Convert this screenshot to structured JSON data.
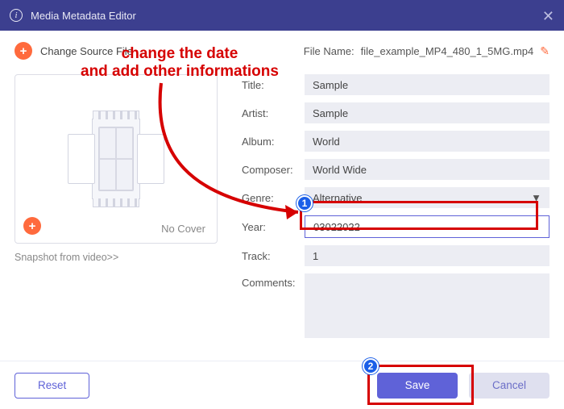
{
  "titlebar": {
    "title": "Media Metadata Editor"
  },
  "toprow": {
    "change_label": "Change Source File",
    "filename_label": "File Name:",
    "filename_value": "file_example_MP4_480_1_5MG.mp4"
  },
  "cover": {
    "nocover": "No Cover",
    "snapshot": "Snapshot from video>>"
  },
  "fields": {
    "title": {
      "label": "Title:",
      "value": "Sample"
    },
    "artist": {
      "label": "Artist:",
      "value": "Sample"
    },
    "album": {
      "label": "Album:",
      "value": "World"
    },
    "composer": {
      "label": "Composer:",
      "value": "World Wide"
    },
    "genre": {
      "label": "Genre:",
      "value": "Alternative"
    },
    "year": {
      "label": "Year:",
      "value": "03022022"
    },
    "track": {
      "label": "Track:",
      "value": "1"
    },
    "comments": {
      "label": "Comments:",
      "value": ""
    }
  },
  "buttons": {
    "reset": "Reset",
    "save": "Save",
    "cancel": "Cancel"
  },
  "annotation": {
    "text": "change the date\nand add other informations",
    "badge1": "1",
    "badge2": "2"
  }
}
